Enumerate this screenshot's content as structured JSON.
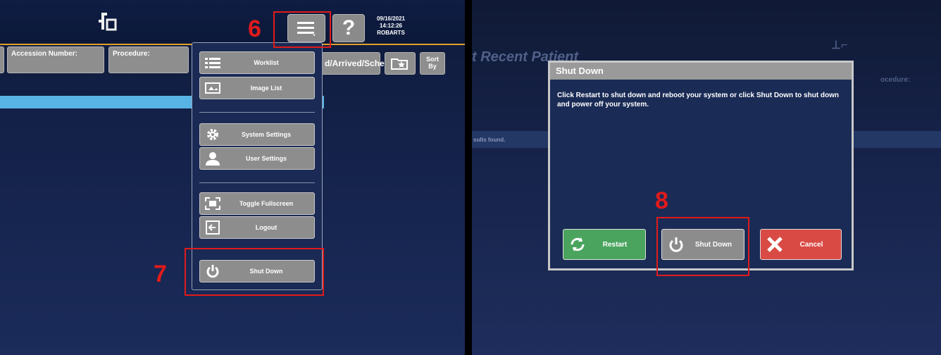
{
  "left_panel": {
    "header": {
      "datetime_date": "09/16/2021",
      "datetime_time": "14:12:26",
      "user": "ROBARTS",
      "help_icon": "question-mark-icon",
      "menu_icon": "hamburger-menu-icon"
    },
    "fields": {
      "accession_label": "Accession Number:",
      "procedure_label": "Procedure:",
      "status_filter": "d/Arrived/Sche",
      "sort_label": "Sort By"
    },
    "annotations": {
      "step6": "6",
      "step7": "7"
    },
    "menu": {
      "items": [
        {
          "label": "Worklist",
          "icon": "list-icon"
        },
        {
          "label": "Image List",
          "icon": "image-list-icon"
        },
        {
          "label": "System Settings",
          "icon": "gear-icon"
        },
        {
          "label": "User Settings",
          "icon": "user-icon"
        },
        {
          "label": "Toggle Fullscreen",
          "icon": "fullscreen-icon"
        },
        {
          "label": "Logout",
          "icon": "logout-icon"
        }
      ],
      "shutdown": {
        "label": "Shut Down",
        "icon": "power-icon"
      }
    }
  },
  "right_panel": {
    "background_title": "t Recent Patient",
    "background_procedure": "ocedure:",
    "background_results": "sults found.",
    "dialog": {
      "title": "Shut Down",
      "message": "Click Restart to shut down and reboot your system or click Shut Down to shut down and power off your system.",
      "buttons": {
        "restart": {
          "label": "Restart",
          "icon": "refresh-icon",
          "color": "#4aa45e"
        },
        "shutdown": {
          "label": "Shut Down",
          "icon": "power-icon",
          "color": "#8c8c8c"
        },
        "cancel": {
          "label": "Cancel",
          "icon": "close-x-icon",
          "color": "#d94a45"
        }
      }
    },
    "annotations": {
      "step8": "8"
    }
  },
  "colors": {
    "accent_orange": "#e2a12a",
    "annotation_red": "#e01b1b",
    "highlight_blue": "#59b4e6"
  }
}
